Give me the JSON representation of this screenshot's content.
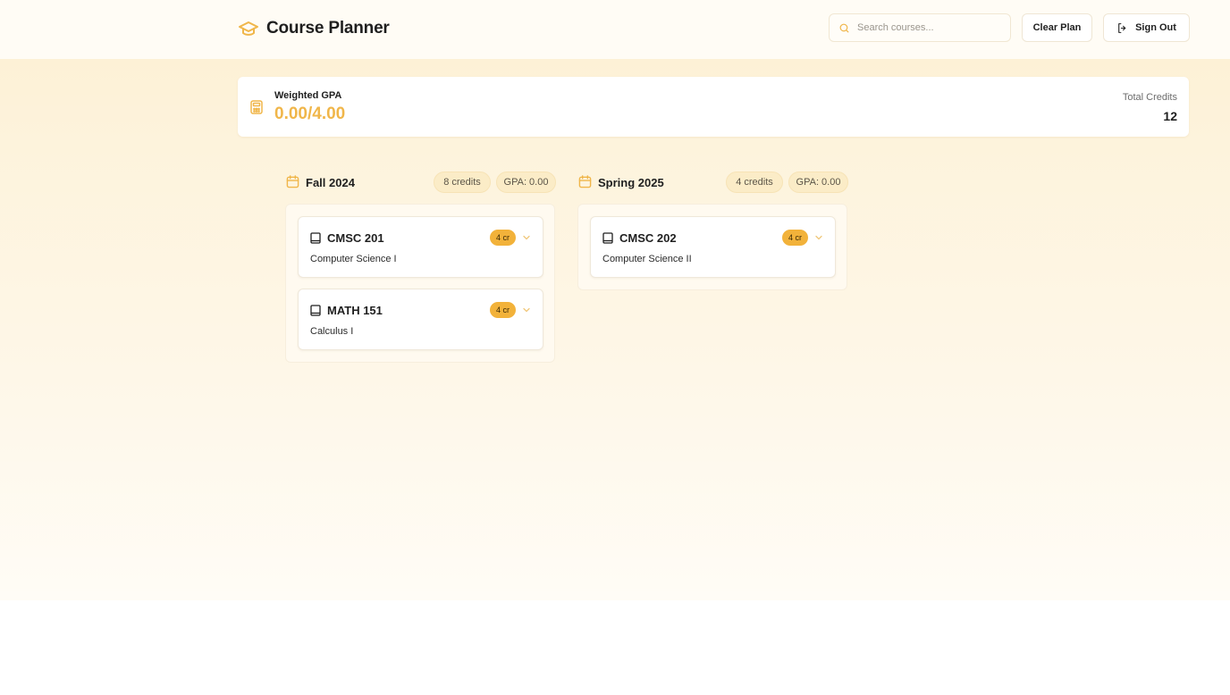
{
  "header": {
    "title": "Course Planner",
    "search_placeholder": "Search courses...",
    "clear_label": "Clear Plan",
    "signout_label": "Sign Out"
  },
  "summary": {
    "gpa_label": "Weighted GPA",
    "gpa_value": "0.00/4.00",
    "credits_label": "Total Credits",
    "credits_value": "12"
  },
  "semesters": [
    {
      "title": "Fall 2024",
      "credits": "8 credits",
      "gpa": "GPA: 0.00",
      "courses": [
        {
          "code": "CMSC 201",
          "name": "Computer Science I",
          "credits": "4 cr"
        },
        {
          "code": "MATH 151",
          "name": "Calculus I",
          "credits": "4 cr"
        }
      ]
    },
    {
      "title": "Spring 2025",
      "credits": "4 credits",
      "gpa": "GPA: 0.00",
      "courses": [
        {
          "code": "CMSC 202",
          "name": "Computer Science II",
          "credits": "4 cr"
        }
      ]
    }
  ],
  "colors": {
    "accent": "#f0b64a",
    "badge": "#f2b23a",
    "pill": "#fbecc7",
    "background": "#fdf1d6"
  },
  "icons": {
    "brand": "graduation-cap-icon",
    "search": "search-icon",
    "signout": "sign-out-icon",
    "gpa": "calculator-icon",
    "semester": "calendar-icon",
    "course": "book-icon",
    "expand": "chevron-down-icon"
  }
}
